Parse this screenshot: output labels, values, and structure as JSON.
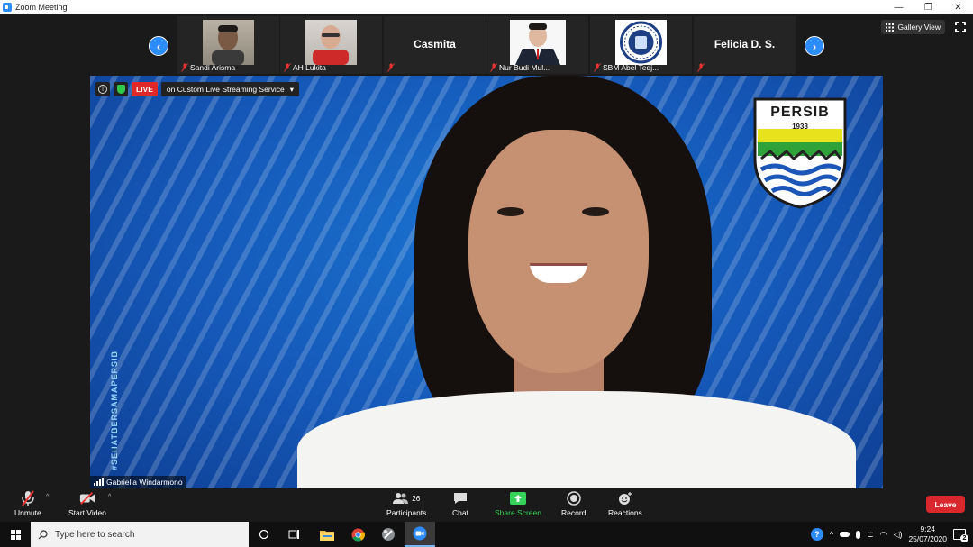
{
  "window": {
    "title": "Zoom Meeting",
    "minimize": "—",
    "restore": "❐",
    "close": "✕"
  },
  "gallery": {
    "prev": "‹",
    "next": "›",
    "view_label": "Gallery View",
    "tiles": [
      {
        "name": "Sandi Arisma",
        "type": "video"
      },
      {
        "name": "AH Lukita",
        "type": "video"
      },
      {
        "name": "Casmita",
        "type": "name"
      },
      {
        "name": "Nur Budi Mul...",
        "type": "video"
      },
      {
        "name": "SBM Abel Tedj...",
        "type": "video"
      },
      {
        "name": "Felicia D. S.",
        "type": "name"
      }
    ]
  },
  "main_video": {
    "live_label": "LIVE",
    "stream_label": "on Custom Live Streaming Service",
    "stream_caret": "▾",
    "info_glyph": "i",
    "speaker_name": "Gabriella Windarmono",
    "logo_text": "PERSIB",
    "logo_year": "1933",
    "side_text": "#SEHATBERSAMAPERSIB"
  },
  "toolbar": {
    "unmute": "Unmute",
    "start_video": "Start Video",
    "participants": "Participants",
    "participants_count": "26",
    "chat": "Chat",
    "share_screen": "Share Screen",
    "record": "Record",
    "reactions": "Reactions",
    "leave": "Leave",
    "caret": "^"
  },
  "taskbar": {
    "search_placeholder": "Type here to search",
    "time": "9:24",
    "date": "25/07/2020",
    "notifications": "2"
  },
  "colors": {
    "accent": "#2d8cff",
    "live": "#e02828",
    "leave": "#d9272e",
    "share": "#36d35a"
  }
}
